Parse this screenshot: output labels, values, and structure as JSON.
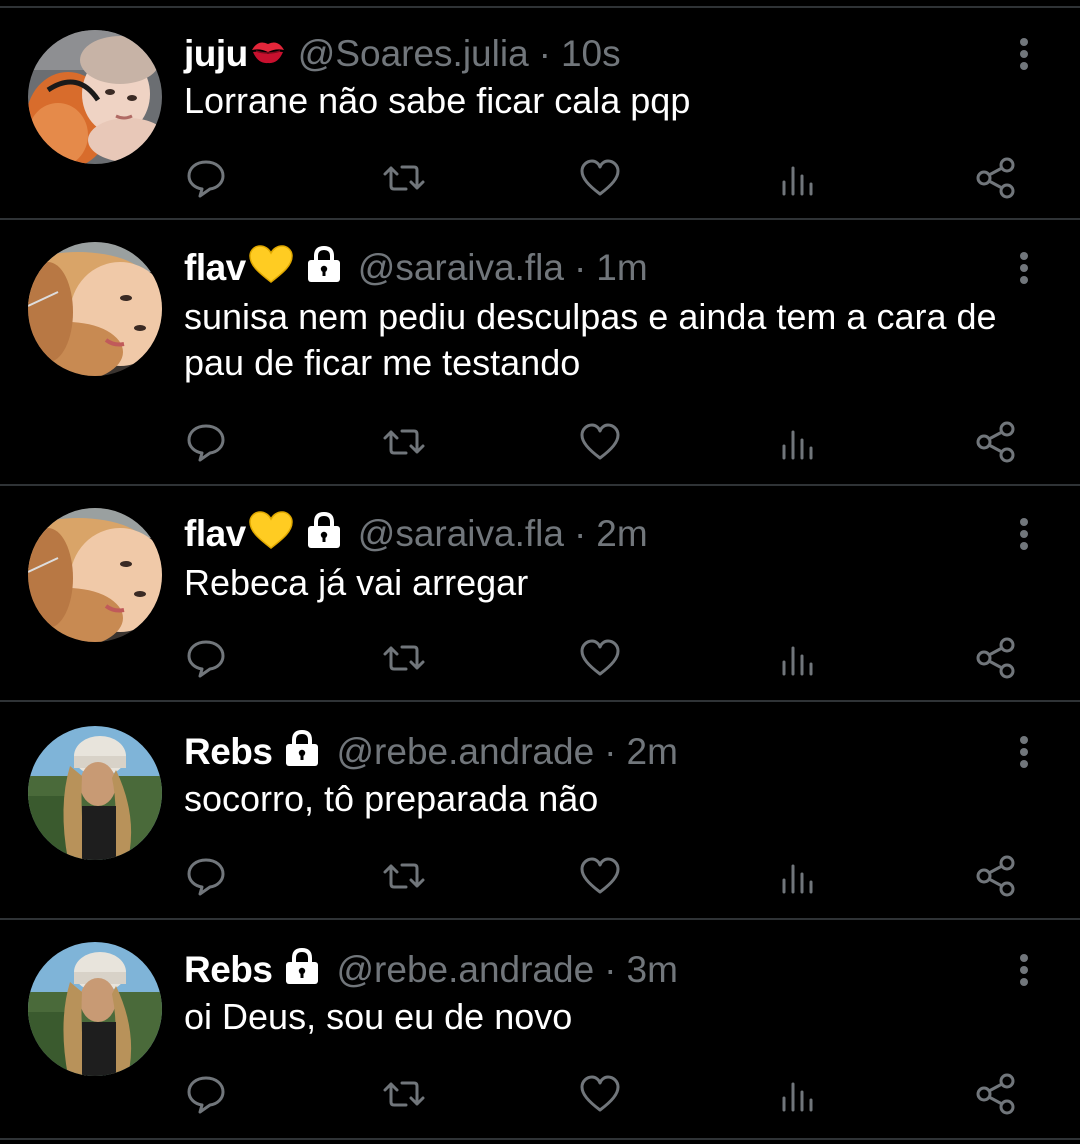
{
  "colors": {
    "background": "#000000",
    "divider": "#2f3336",
    "name_text": "#ffffff",
    "body_text": "#ffffff",
    "muted_text": "#71767b",
    "icon": "#71767b"
  },
  "tweets": [
    {
      "name": "juju",
      "name_emoji": "kiss-mark",
      "locked": false,
      "handle": "@Soares.julia",
      "separator": "·",
      "time": "10s",
      "text": "Lorrane não sabe ficar cala pqp",
      "avatar": "avatar-juju"
    },
    {
      "name": "flav",
      "name_emoji": "yellow-heart",
      "locked": true,
      "handle": "@saraiva.fla",
      "separator": "·",
      "time": "1m",
      "text": "sunisa nem pediu desculpas e ainda tem a cara de pau de ficar me testando",
      "avatar": "avatar-flav"
    },
    {
      "name": "flav",
      "name_emoji": "yellow-heart",
      "locked": true,
      "handle": "@saraiva.fla",
      "separator": "·",
      "time": "2m",
      "text": "Rebeca já vai arregar",
      "avatar": "avatar-flav"
    },
    {
      "name": "Rebs",
      "name_emoji": "",
      "locked": true,
      "handle": "@rebe.andrade",
      "separator": "·",
      "time": "2m",
      "text": "socorro, tô preparada não",
      "avatar": "avatar-rebs"
    },
    {
      "name": "Rebs",
      "name_emoji": "",
      "locked": true,
      "handle": "@rebe.andrade",
      "separator": "·",
      "time": "3m",
      "text": "oi Deus, sou eu de novo",
      "avatar": "avatar-rebs"
    }
  ],
  "actions": [
    "reply-icon",
    "retweet-icon",
    "like-icon",
    "views-icon",
    "share-icon"
  ]
}
